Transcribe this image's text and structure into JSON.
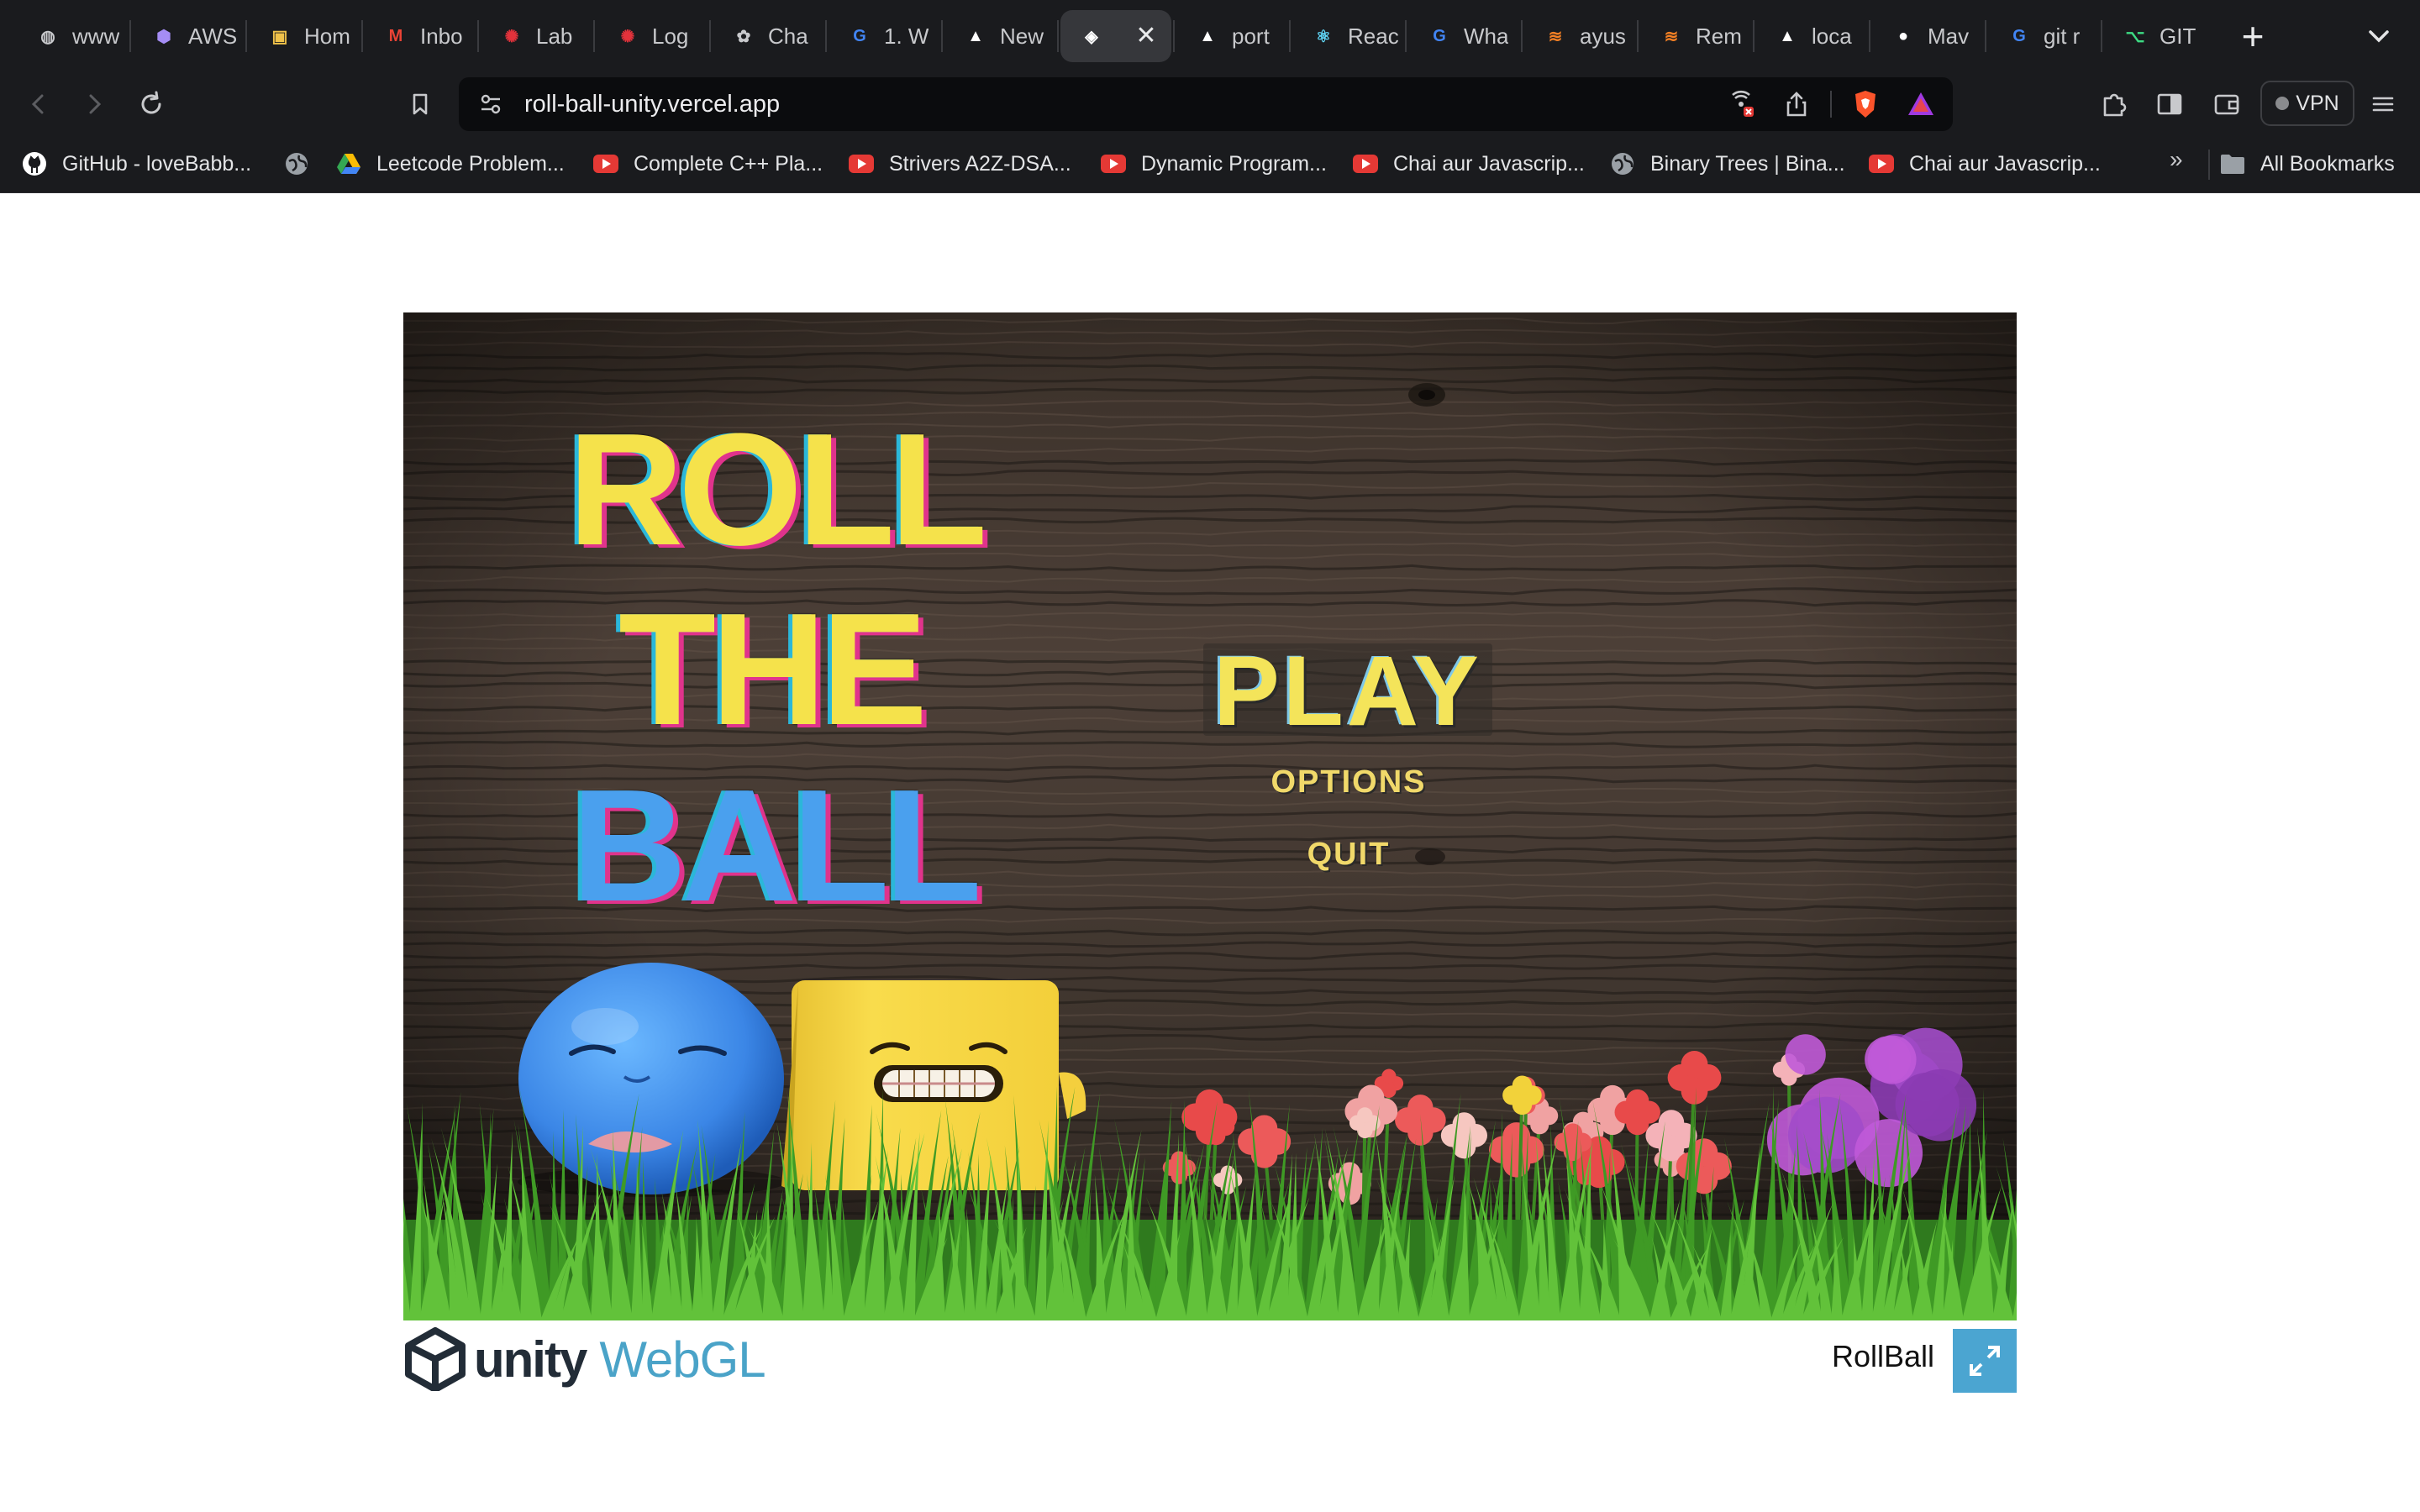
{
  "browser": {
    "tabs": [
      {
        "label": "www",
        "icon": "globe-icon",
        "color": "#c8c9cc"
      },
      {
        "label": "AWS",
        "icon": "aws-cube-icon",
        "color": "#a58df5"
      },
      {
        "label": "Hom",
        "icon": "image-icon",
        "color": "#f0c24a"
      },
      {
        "label": "Inbo",
        "icon": "gmail-icon",
        "color": "#ea4335"
      },
      {
        "label": "Lab",
        "icon": "lab-icon",
        "color": "#e2323b"
      },
      {
        "label": "Log",
        "icon": "lab-icon",
        "color": "#e2323b"
      },
      {
        "label": "Cha",
        "icon": "chatgpt-icon",
        "color": "#c8c9cc"
      },
      {
        "label": "1. W",
        "icon": "google-icon",
        "color": "#4285f4"
      },
      {
        "label": "New",
        "icon": "vercel-icon",
        "color": "#ffffff"
      },
      {
        "label": "",
        "icon": "unity-icon",
        "color": "#ffffff",
        "active": true
      },
      {
        "label": "port",
        "icon": "vercel-icon",
        "color": "#ffffff"
      },
      {
        "label": "Reac",
        "icon": "react-icon",
        "color": "#61dafb"
      },
      {
        "label": "Wha",
        "icon": "google-icon",
        "color": "#4285f4"
      },
      {
        "label": "ayus",
        "icon": "stack-icon",
        "color": "#f48024"
      },
      {
        "label": "Rem",
        "icon": "stack-icon",
        "color": "#f48024"
      },
      {
        "label": "loca",
        "icon": "vercel-icon",
        "color": "#ffffff"
      },
      {
        "label": "Mav",
        "icon": "github-icon",
        "color": "#ffffff"
      },
      {
        "label": "git r",
        "icon": "google-icon",
        "color": "#4285f4"
      },
      {
        "label": "GIT",
        "icon": "git-icon",
        "color": "#3ddc84"
      }
    ],
    "url": "roll-ball-unity.vercel.app",
    "vpn_label": "VPN",
    "bookmarks": [
      {
        "label": "GitHub - loveBabb...",
        "icon": "github-icon"
      },
      {
        "label": "",
        "icon": "globe-icon"
      },
      {
        "label": "Leetcode Problem...",
        "icon": "drive-icon"
      },
      {
        "label": "Complete C++ Pla...",
        "icon": "youtube-icon"
      },
      {
        "label": "Strivers A2Z-DSA...",
        "icon": "youtube-icon"
      },
      {
        "label": "Dynamic Program...",
        "icon": "youtube-icon"
      },
      {
        "label": "Chai aur Javascrip...",
        "icon": "youtube-icon"
      },
      {
        "label": "Binary Trees | Bina...",
        "icon": "globe-icon"
      },
      {
        "label": "Chai aur Javascrip...",
        "icon": "youtube-icon"
      }
    ],
    "bookmarks_more": "»",
    "all_bookmarks_label": "All Bookmarks"
  },
  "game": {
    "title_lines": [
      "ROLL",
      "THE",
      "BALL"
    ],
    "menu": {
      "play": "PLAY",
      "options": "OPTIONS",
      "quit": "QUIT"
    },
    "colors": {
      "wood_dark": "#2c241e",
      "wood_light": "#5a4a3e",
      "title_yellow": "#f5e24b",
      "title_blue": "#4aa0ee",
      "grass": "#49b52a"
    }
  },
  "footer": {
    "unity_text": "unity",
    "webgl_text": "WebGL",
    "game_name": "RollBall",
    "fullscreen_color": "#4ba5d1"
  }
}
